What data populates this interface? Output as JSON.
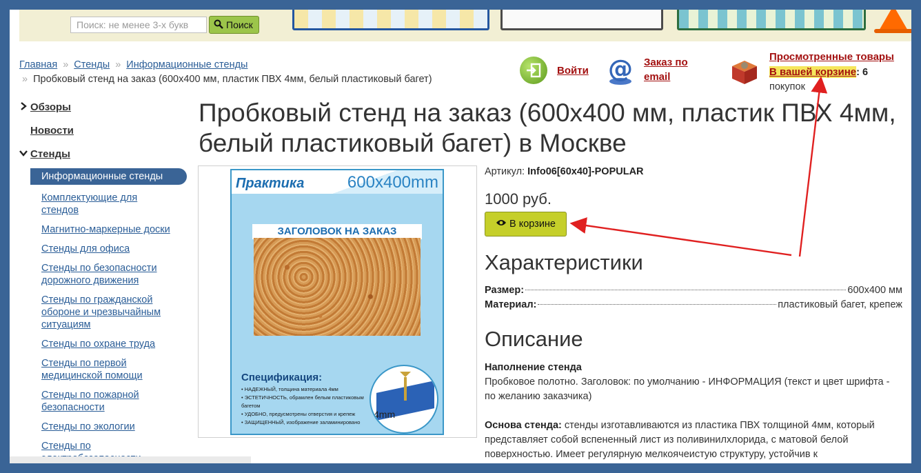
{
  "search": {
    "placeholder": "Поиск: не менее 3-х букв",
    "button_label": "Поиск"
  },
  "breadcrumb": {
    "home": "Главная",
    "sep": "»",
    "level1": "Стенды",
    "level2": "Информационные стенды",
    "current": "Пробковый стенд на заказ (600x400 мм, пластик ПВХ 4мм, белый пластиковый багет)"
  },
  "user": {
    "login_label": "Войти",
    "order_email_line1": "Заказ по",
    "order_email_line2": "email",
    "viewed_label": "Просмотренные товары",
    "cart_label": "В вашей корзине",
    "cart_colon": ":",
    "cart_count": "6",
    "cart_unit": "покупок"
  },
  "sidebar": {
    "reviews": "Обзоры",
    "news": "Новости",
    "stands": "Стенды",
    "active": "Информационные стенды",
    "items": [
      "Комплектующие для стендов",
      "Магнитно-маркерные доски",
      "Стенды для офиса",
      "Стенды по безопасности дорожного движения",
      "Стенды по гражданской обороне и чрезвычайным ситуациям",
      "Стенды по охране труда",
      "Стенды по первой медицинской помощи",
      "Стенды по пожарной безопасности",
      "Стенды по экологии",
      "Стенды по электробезопасности"
    ]
  },
  "product": {
    "title": "Пробковый стенд на заказ (600x400 мм, пластик ПВХ 4мм, белый пластиковый багет) в Москве",
    "article_label": "Артикул:",
    "article_value": "Info06[60x40]-POPULAR",
    "price": "1000 руб.",
    "in_cart_label": "В корзине",
    "image": {
      "brand": "Практика",
      "size": "600x400mm",
      "heading": "ЗАГОЛОВОК НА ЗАКАЗ",
      "spec_title": "Спецификация:",
      "spec_lines": [
        "• НАДЕЖНЫЙ, толщина материала 4мм",
        "• ЭСТЕТИЧНОСТЬ, обрамлен белым пластиковым багетом",
        "• УДОБНО, предусмотрены отверстия и крепеж",
        "• ЗАЩИЩЕННЫЙ, изображение заламинировано"
      ],
      "thickness": "4mm"
    }
  },
  "characteristics": {
    "heading": "Характеристики",
    "size_label": "Размер:",
    "size_value": "600x400 мм",
    "material_label": "Материал:",
    "material_value": "пластиковый багет, крепеж"
  },
  "description": {
    "heading": "Описание",
    "fill_title": "Наполнение стенда",
    "fill_text": "Пробковое полотно. Заголовок: по умолчанию - ИНФОРМАЦИЯ (текст и цвет шрифта - по желанию заказчика)",
    "base_title": "Основа стенда:",
    "base_text": " стенды изготавливаются из пластика ПВХ толщиной 4мм, который представляет собой вспененный лист из поливинилхлорида, с матовой белой поверхностью. Имеет регулярную мелкоячеистую структуру, устойчив к"
  },
  "colors": {
    "frame": "#3a6496",
    "link": "#2a5d97",
    "accent_link": "#a31010",
    "highlight": "#f5e65c",
    "cart_button": "#c5cf2a",
    "search_button": "#9cc54a",
    "annotation_arrow": "#e02020"
  },
  "icons": [
    "search-icon",
    "login-icon",
    "email-icon",
    "cart-box-icon",
    "eye-icon",
    "chevron-right-icon",
    "chevron-down-icon"
  ]
}
